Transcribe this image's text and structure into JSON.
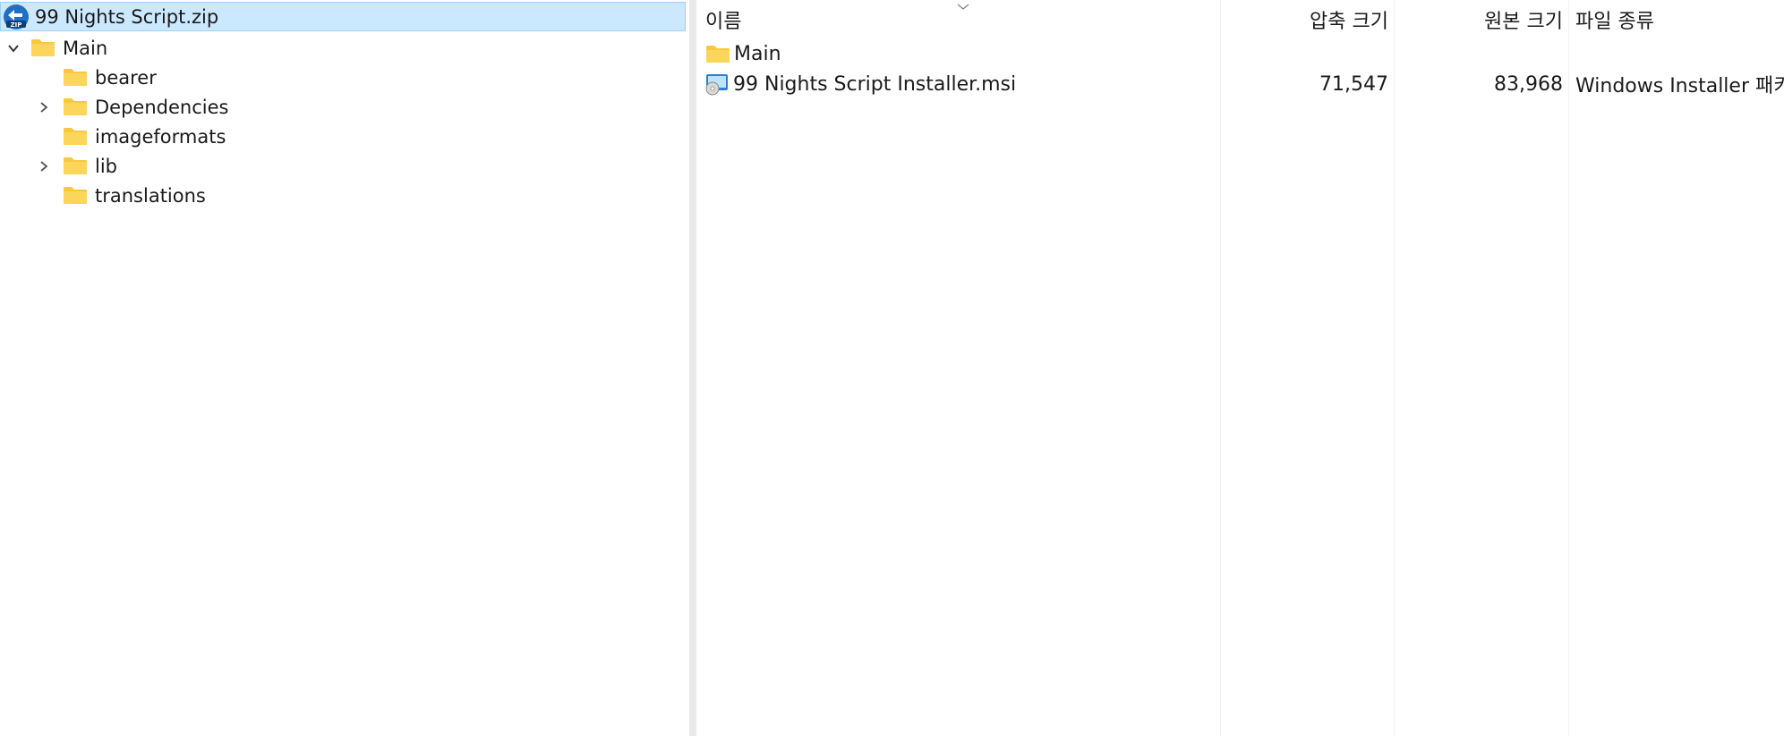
{
  "tree": {
    "root": {
      "label": "99 Nights Script.zip",
      "icon": "zip-archive-icon"
    },
    "main": {
      "label": "Main",
      "expanded": true
    },
    "children": [
      {
        "label": "bearer",
        "has_children": false
      },
      {
        "label": "Dependencies",
        "has_children": true
      },
      {
        "label": "imageformats",
        "has_children": false
      },
      {
        "label": "lib",
        "has_children": true
      },
      {
        "label": "translations",
        "has_children": false
      }
    ]
  },
  "list": {
    "columns": {
      "name": "이름",
      "compressed": "압축 크기",
      "original": "원본 크기",
      "type": "파일 종류"
    },
    "sort": {
      "column": "name",
      "icon": "chevron-down-icon"
    },
    "rows": [
      {
        "name": "Main",
        "icon": "folder-icon",
        "compressed": "",
        "original": "",
        "type": ""
      },
      {
        "name": "99 Nights Script Installer.msi",
        "icon": "msi-installer-icon",
        "compressed": "71,547",
        "original": "83,968",
        "type": "Windows Installer 패키지"
      }
    ]
  },
  "colors": {
    "selection": "#cce8ff",
    "selection_border": "#99d1ff",
    "folder": "#f8c93f",
    "splitter": "#e9e9e9"
  }
}
